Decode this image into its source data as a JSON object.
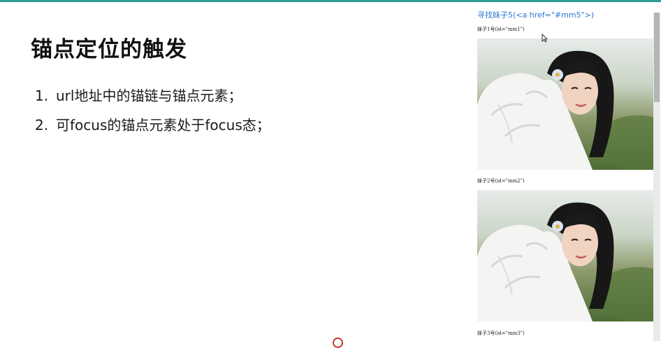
{
  "slide": {
    "title": "锚点定位的触发",
    "points": [
      {
        "num": "1.",
        "text": "url地址中的锚链与锚点元素；"
      },
      {
        "num": "2.",
        "text": "可focus的锚点元素处于focus态；"
      }
    ]
  },
  "browser": {
    "link_text": "寻找妹子5(<a href=\"#mm5\">)",
    "sisters": [
      {
        "label": "妹子1号(id=\"mm1\")"
      },
      {
        "label": "妹子2号(id=\"mm2\")"
      },
      {
        "label": "妹子3号(id=\"mm3\")"
      }
    ]
  },
  "icons": {
    "cursor": "arrow-cursor-icon",
    "photo": "girl-photo",
    "ring": "recording-ring-icon"
  },
  "colors": {
    "accent_bar": "#2a9d95",
    "link": "#2c78d4",
    "title": "#111111"
  }
}
